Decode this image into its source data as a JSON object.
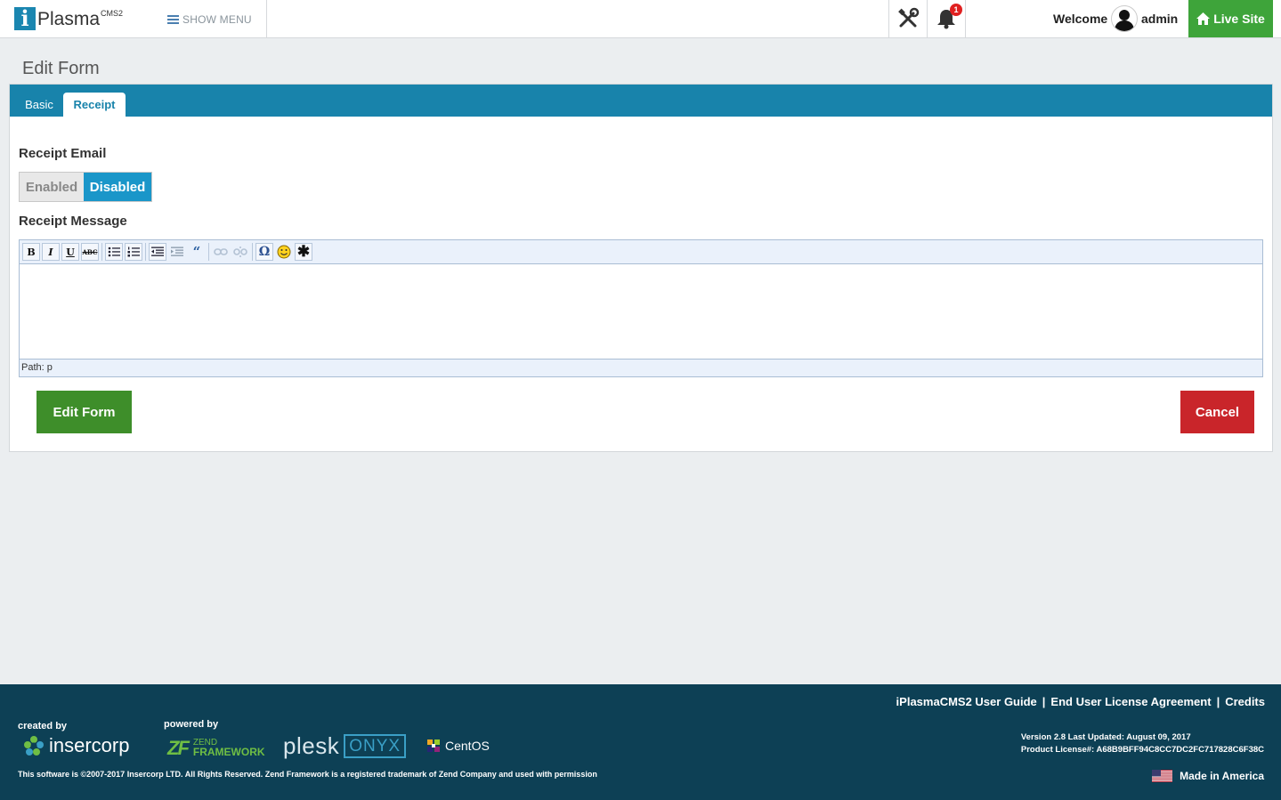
{
  "header": {
    "logo_text": "Plasma",
    "logo_sup": "CMS2",
    "logo_letter": "i",
    "show_menu": "SHOW MENU",
    "notification_count": "1",
    "welcome": "Welcome",
    "username": "admin",
    "live_site": "Live Site"
  },
  "page": {
    "title": "Edit Form",
    "tabs": [
      {
        "label": "Basic",
        "active": false
      },
      {
        "label": "Receipt",
        "active": true
      }
    ],
    "receipt_email_label": "Receipt Email",
    "toggle": {
      "enabled_label": "Enabled",
      "disabled_label": "Disabled",
      "selected": "Disabled"
    },
    "receipt_message_label": "Receipt Message",
    "editor": {
      "path": "Path: p",
      "toolbar": [
        "bold",
        "italic",
        "underline",
        "strikethrough",
        "bullet-list",
        "numbered-list",
        "outdent",
        "indent",
        "blockquote",
        "link",
        "unlink",
        "special-char",
        "emoticon",
        "other"
      ]
    },
    "edit_button": "Edit Form",
    "cancel_button": "Cancel"
  },
  "footer": {
    "links": [
      "iPlasmaCMS2 User Guide",
      "End User License Agreement",
      "Credits"
    ],
    "created_by": "created by",
    "powered_by": "powered by",
    "insercorp": "insercorp",
    "zend_line1": "ZEND",
    "zend_line2": "FRAMEWORK",
    "plesk": "plesk",
    "onyx": "ONYX",
    "centos": "CentOS",
    "copyright": "This software is ©2007-2017 Insercorp LTD. All Rights Reserved. Zend Framework is a registered trademark of Zend Company and used with permission",
    "version": "Version 2.8 Last Updated: August 09, 2017",
    "license": "Product License#: A68B9BFF94C8CC7DC2FC717828C6F38C",
    "made_in": "Made in America"
  },
  "colors": {
    "tabbar": "#1883ab",
    "live_site": "#3ea43a",
    "edit_button": "#3e8e2a",
    "cancel_button": "#c9252a",
    "toggle_active": "#1a96c9",
    "footer": "#0d4055"
  }
}
